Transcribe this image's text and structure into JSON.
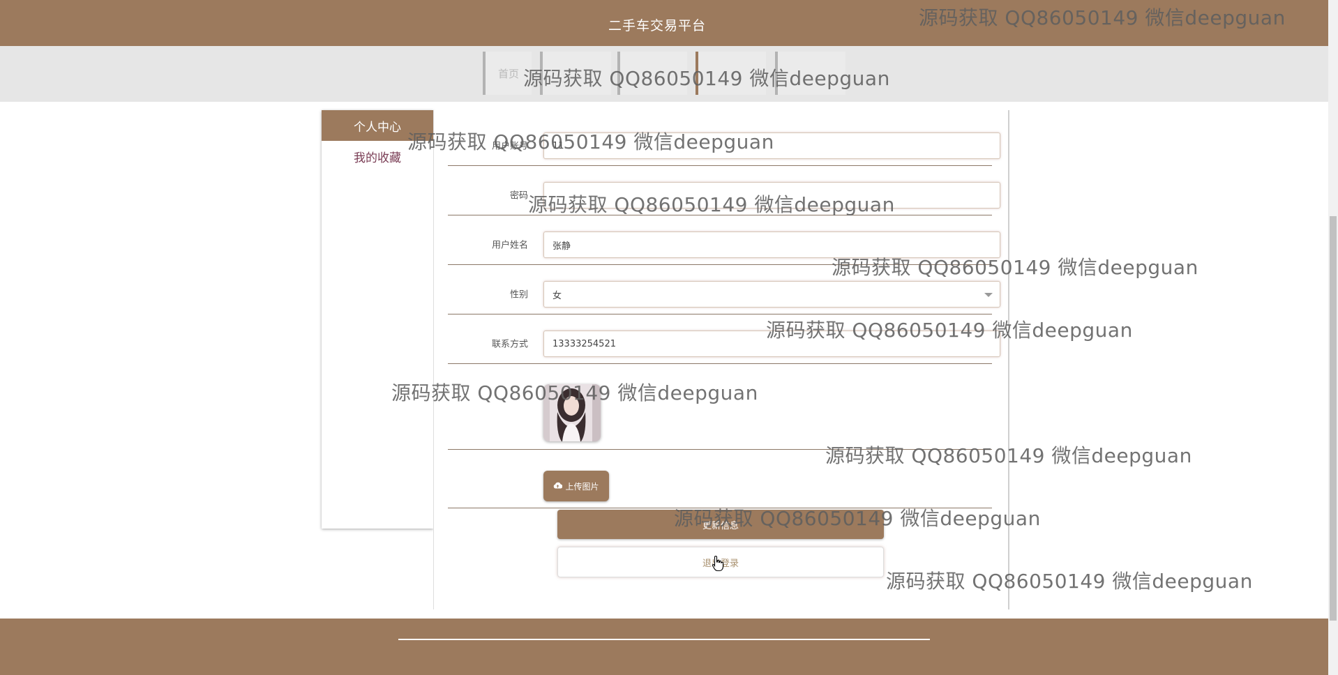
{
  "header": {
    "title": "二手车交易平台"
  },
  "nav": {
    "items": [
      {
        "label": "首页"
      },
      {
        "label": ""
      },
      {
        "label": ""
      },
      {
        "label": ""
      },
      {
        "label": ""
      }
    ],
    "active_index": 3
  },
  "sidebar": {
    "title": "个人中心",
    "items": [
      {
        "label": "我的收藏"
      }
    ]
  },
  "form": {
    "account": {
      "label": "用户账号",
      "value": "11"
    },
    "password": {
      "label": "密码",
      "value": ""
    },
    "name": {
      "label": "用户姓名",
      "value": "张静"
    },
    "gender": {
      "label": "性别",
      "value": "女"
    },
    "phone": {
      "label": "联系方式",
      "value": "13333254521"
    },
    "upload_label": "上传图片",
    "update_label": "更新信息",
    "logout_label": "退出登录"
  },
  "watermark": {
    "text": "源码获取 QQ86050149 微信deepguan"
  },
  "colors": {
    "brand": "#9c7a5d",
    "footer": "#9c7a5d",
    "link": "#7a3d55"
  }
}
